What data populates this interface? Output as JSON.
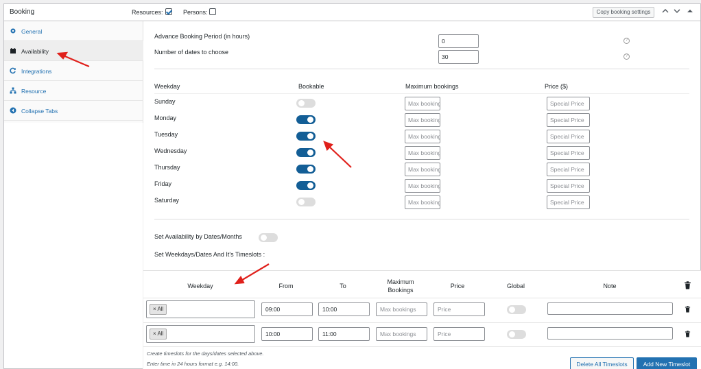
{
  "header": {
    "title": "Booking",
    "resources_label": "Resources:",
    "resources_checked": true,
    "persons_label": "Persons:",
    "persons_checked": false,
    "copy_button": "Copy booking settings",
    "icons": [
      "chevron-up-icon",
      "chevron-down-icon",
      "caret-up-icon"
    ]
  },
  "sidebar": {
    "tabs": [
      {
        "label": "General",
        "icon": "gear-icon",
        "active": false
      },
      {
        "label": "Availability",
        "icon": "calendar-icon",
        "active": true
      },
      {
        "label": "Integrations",
        "icon": "refresh-icon",
        "active": false
      },
      {
        "label": "Resource",
        "icon": "network-icon",
        "active": false
      },
      {
        "label": "Collapse Tabs",
        "icon": "collapse-icon",
        "active": false
      }
    ]
  },
  "availability": {
    "advance_label": "Advance Booking Period (in hours)",
    "advance_value": "0",
    "dates_label": "Number of dates to choose",
    "dates_value": "30"
  },
  "weekday_table": {
    "headers": [
      "Weekday",
      "Bookable",
      "Maximum bookings",
      "Price ($)"
    ],
    "max_placeholder": "Max bookings",
    "price_placeholder": "Special Price",
    "rows": [
      {
        "day": "Sunday",
        "bookable": false
      },
      {
        "day": "Monday",
        "bookable": true
      },
      {
        "day": "Tuesday",
        "bookable": true
      },
      {
        "day": "Wednesday",
        "bookable": true
      },
      {
        "day": "Thursday",
        "bookable": true
      },
      {
        "day": "Friday",
        "bookable": true
      },
      {
        "day": "Saturday",
        "bookable": false
      }
    ]
  },
  "dates_months": {
    "label": "Set Availability by Dates/Months",
    "enabled": false
  },
  "timeslots_heading": "Set Weekdays/Dates And It's Timeslots :",
  "timeslots": {
    "headers": {
      "weekday": "Weekday",
      "from": "From",
      "to": "To",
      "max_line1": "Maximum",
      "max_line2": "Bookings",
      "price": "Price",
      "global": "Global",
      "note": "Note"
    },
    "max_placeholder": "Max bookings",
    "price_placeholder": "Price",
    "rows": [
      {
        "tag": "All",
        "from": "09:00",
        "to": "10:00",
        "global": false
      },
      {
        "tag": "All",
        "from": "10:00",
        "to": "11:00",
        "global": false
      }
    ],
    "notes": [
      "Create timeslots for the days/dates selected above.",
      "Enter time in 24 hours format e.g. 14:00."
    ],
    "delete_all": "Delete All Timeslots",
    "add_new": "Add New Timeslot"
  },
  "colors": {
    "accent": "#2271b1",
    "toggle_on": "#135e96",
    "arrow": "#e0201b"
  }
}
